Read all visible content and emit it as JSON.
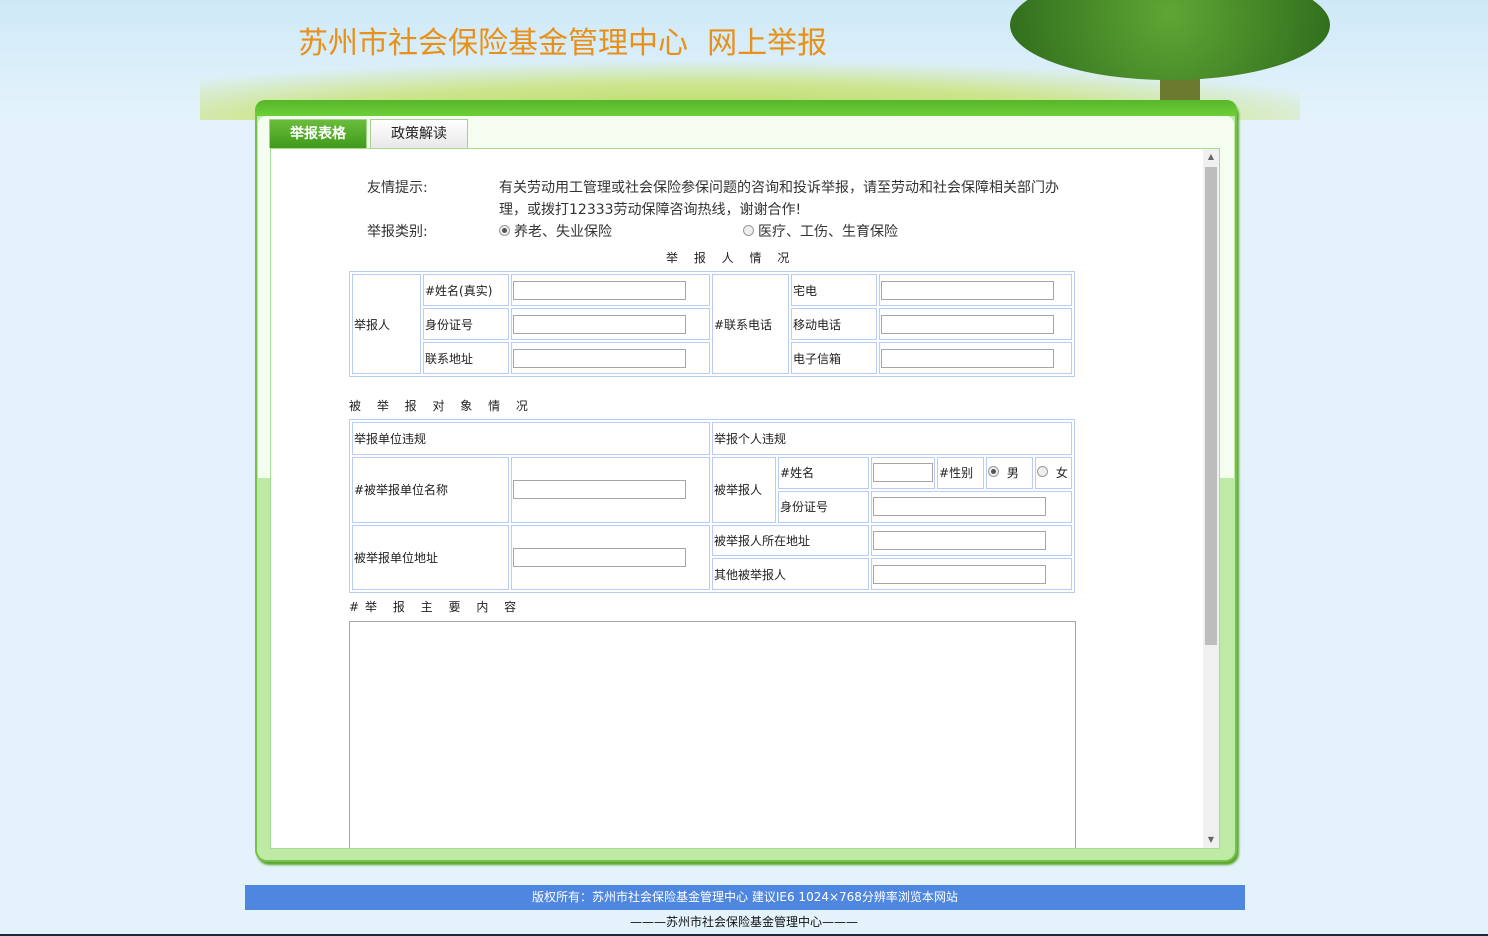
{
  "header": {
    "title": "苏州市社会保险基金管理中心  网上举报"
  },
  "tabs": [
    {
      "label": "举报表格",
      "active": true
    },
    {
      "label": "政策解读",
      "active": false
    }
  ],
  "notice": {
    "label": "友情提示:",
    "text": "有关劳动用工管理或社会保险参保问题的咨询和投诉举报，请至劳动和社会保障相关部门办理，或拨打12333劳动保障咨询热线，谢谢合作!"
  },
  "category": {
    "label": "举报类别:",
    "options": [
      {
        "label": "养老、失业保险",
        "checked": true
      },
      {
        "label": "医疗、工伤、生育保险",
        "checked": false
      }
    ]
  },
  "reporter": {
    "section": "举 报 人 情 况",
    "group": "举报人",
    "name": "#姓名(真实)",
    "id": "身份证号",
    "address": "联系地址",
    "contact": "#联系电话",
    "home_phone": "宅电",
    "mobile": "移动电话",
    "email": "电子信箱"
  },
  "target": {
    "section": "被 举 报 对 象 情 况",
    "unit_header": "举报单位违规",
    "person_header": "举报个人违规",
    "unit_name": "#被举报单位名称",
    "unit_address": "被举报单位地址",
    "person_group": "被举报人",
    "person_name": "#姓名",
    "gender": "#性别",
    "male": "男",
    "female": "女",
    "person_id": "身份证号",
    "person_address": "被举报人所在地址",
    "others": "其他被举报人"
  },
  "content": {
    "label": "#举 报 主 要 内 容"
  },
  "footer": {
    "copyright": "版权所有：苏州市社会保险基金管理中心 建议IE6 1024×768分辨率浏览本网站",
    "org": "———苏州市社会保险基金管理中心———"
  },
  "colors": {
    "accent": "#e8911a",
    "footer": "#4f87e0",
    "tab": "#3f9a1b"
  }
}
